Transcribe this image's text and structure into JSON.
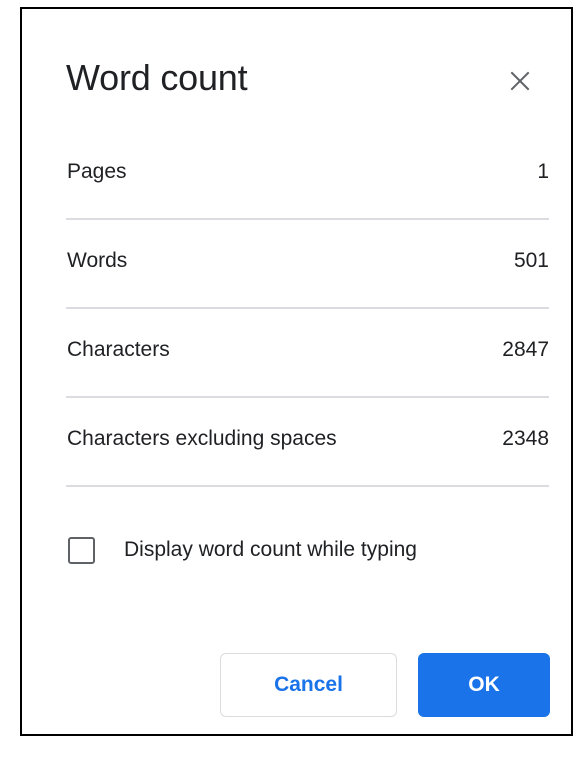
{
  "dialog": {
    "title": "Word count",
    "close_icon": "close-icon",
    "stats": [
      {
        "label": "Pages",
        "value": "1"
      },
      {
        "label": "Words",
        "value": "501"
      },
      {
        "label": "Characters",
        "value": "2847"
      },
      {
        "label": "Characters excluding spaces",
        "value": "2348"
      }
    ],
    "display_while_typing": {
      "label": "Display word count while typing",
      "checked": false
    },
    "buttons": {
      "cancel_label": "Cancel",
      "ok_label": "OK"
    }
  },
  "colors": {
    "accent": "#1a73e8",
    "text": "#202124",
    "divider": "#dadce0",
    "checkbox_border": "#5f6368"
  }
}
